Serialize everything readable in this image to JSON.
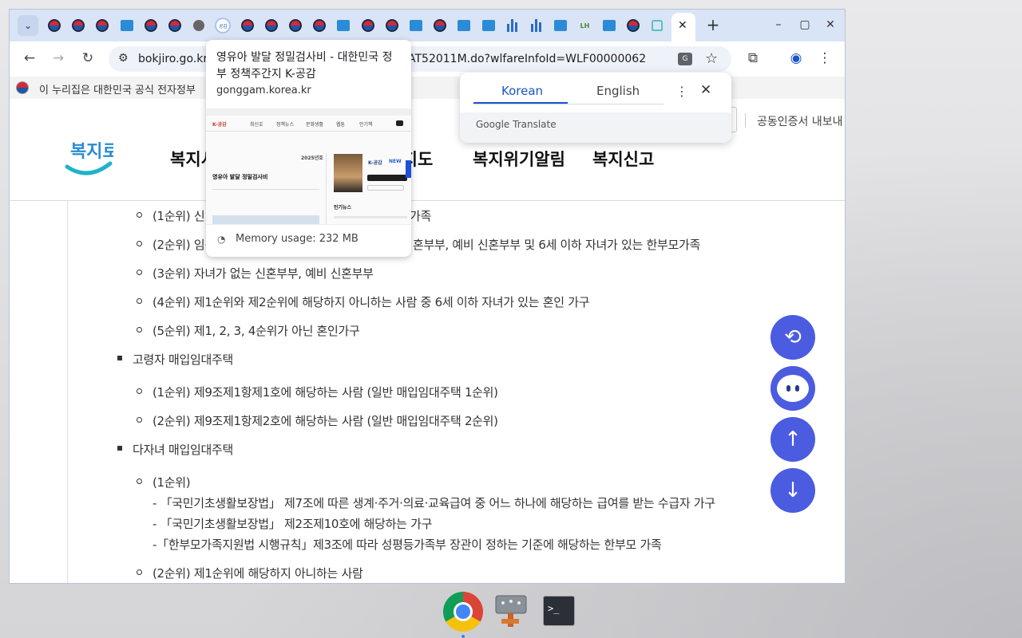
{
  "browser": {
    "tab_list_icon": "chevron-down-icon",
    "tab_favicons": [
      "taeguk",
      "taeguk",
      "taeguk",
      "box",
      "taeguk",
      "taeguk",
      "globe",
      "gonggam",
      "taeguk",
      "taeguk",
      "taeguk",
      "taeguk",
      "box",
      "taeguk",
      "taeguk",
      "box",
      "taeguk",
      "box",
      "box",
      "bars",
      "bars",
      "box",
      "lh",
      "box",
      "taeguk",
      "house"
    ],
    "gonggam_fav_text": "공감",
    "active_tab_close": "✕",
    "new_tab": "+",
    "window_controls": {
      "minimize": "–",
      "maximize": "▢",
      "close": "✕"
    }
  },
  "toolbar": {
    "back": "←",
    "forward": "→",
    "reload": "↻",
    "url_host": "bokjiro.go.kr",
    "url_path": "AT52011M.do?wlfareInfoId=WLF00000062",
    "translate_icon_text": "G",
    "star": "☆",
    "extensions": "⧉",
    "profile": "◉",
    "menu": "⋮"
  },
  "banner": {
    "text": "이 누리집은 대한민국 공식 전자정부"
  },
  "site": {
    "logo": "복지로",
    "cert_link": "공동인증서 내보내",
    "nav": [
      "복지서비스",
      "복지지도",
      "복지위기알림",
      "복지신고"
    ]
  },
  "content": {
    "lines": [
      "(1순위) 신혼부부, 예비 신혼부부, 한부모가족",
      "(2순위) 임신 중이거나 6세 이하 자녀가 있는 신혼부부, 예비 신혼부부 및 6세 이하 자녀가 있는 한부모가족",
      "(3순위) 자녀가 없는 신혼부부, 예비 신혼부부",
      "(4순위) 제1순위와 제2순위에 해당하지 아니하는 사람 중 6세 이하 자녀가 있는 혼인 가구",
      "(5순위) 제1, 2, 3, 4순위가 아닌 혼인가구",
      "고령자 매입임대주택",
      "(1순위) 제9조제1항제1호에 해당하는 사람 (일반 매입임대주택 1순위)",
      "(2순위) 제9조제1항제2호에 해당하는 사람 (일반 매입임대주택 2순위)",
      "다자녀 매입임대주택",
      "(1순위)",
      "- 「국민기초생활보장법」 제7조에 따른 생계·주거·의료·교육급여 중 어느 하나에 해당하는 급여를 받는 수급자 가구",
      "- 「국민기초생활보장법」 제2조제10호에 해당하는 가구",
      "-「한부모가족지원법 시행규칙」제3조에 따라 성평등가족부 장관이 정하는 기준에 해당하는 한부모 가족",
      "(2순위) 제1순위에 해당하지 아니하는 사람"
    ],
    "line1_visible": [
      "(1순위) 신",
      "가족"
    ],
    "line2_visible": [
      "(2순위) 임신",
      "혼부부, 예비 신혼부부 및 6세 이하 자녀가 있는 한부모가족"
    ]
  },
  "fabs": [
    {
      "name": "history-icon",
      "glyph": "⟲"
    },
    {
      "name": "chatbot-icon",
      "glyph": ""
    },
    {
      "name": "arrow-up-icon",
      "glyph": "↑"
    },
    {
      "name": "arrow-down-icon",
      "glyph": "↓"
    }
  ],
  "hover_card": {
    "title": "영유아 발달 정밀검사비 - 대한민국 정부 정책주간지 K-공감",
    "domain": "gonggam.korea.kr",
    "memory": "Memory usage: 232 MB",
    "thumb_texts": {
      "nav": [
        "최신호",
        "정책뉴스",
        "문화생활",
        "웹툰",
        "인기책"
      ],
      "logo": "K-공감",
      "article_title": "영유아 발달 정밀검사비",
      "date_label": "2025년호",
      "side_title": "K-공감",
      "side_badge": "NEW",
      "popular": "인기뉴스"
    }
  },
  "translate": {
    "tab_source": "Korean",
    "tab_target": "English",
    "brand": "Google Translate",
    "more": "⋮",
    "close": "✕"
  },
  "dock": {
    "terminal_prompt": ">_"
  }
}
